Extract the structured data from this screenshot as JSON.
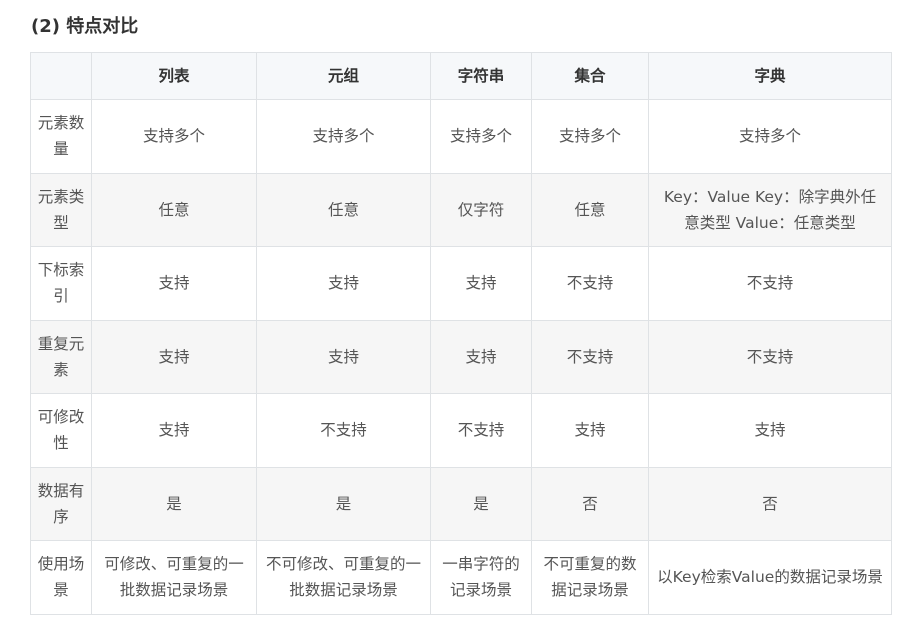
{
  "heading": "(2) 特点对比",
  "table": {
    "headers": [
      "",
      "列表",
      "元组",
      "字符串",
      "集合",
      "字典"
    ],
    "rows": [
      {
        "label": "元素数量",
        "cells": [
          "支持多个",
          "支持多个",
          "支持多个",
          "支持多个",
          "支持多个"
        ]
      },
      {
        "label": "元素类型",
        "cells": [
          "任意",
          "任意",
          "仅字符",
          "任意",
          "Key：Value Key：除字典外任意类型 Value：任意类型"
        ]
      },
      {
        "label": "下标索引",
        "cells": [
          "支持",
          "支持",
          "支持",
          "不支持",
          "不支持"
        ]
      },
      {
        "label": "重复元素",
        "cells": [
          "支持",
          "支持",
          "支持",
          "不支持",
          "不支持"
        ]
      },
      {
        "label": "可修改性",
        "cells": [
          "支持",
          "不支持",
          "不支持",
          "支持",
          "支持"
        ]
      },
      {
        "label": "数据有序",
        "cells": [
          "是",
          "是",
          "是",
          "否",
          "否"
        ]
      },
      {
        "label": "使用场景",
        "cells": [
          "可修改、可重复的一批数据记录场景",
          "不可修改、可重复的一批数据记录场景",
          "一串字符的记录场景",
          "不可重复的数据记录场景",
          "以Key检索Value的数据记录场景"
        ]
      }
    ]
  }
}
